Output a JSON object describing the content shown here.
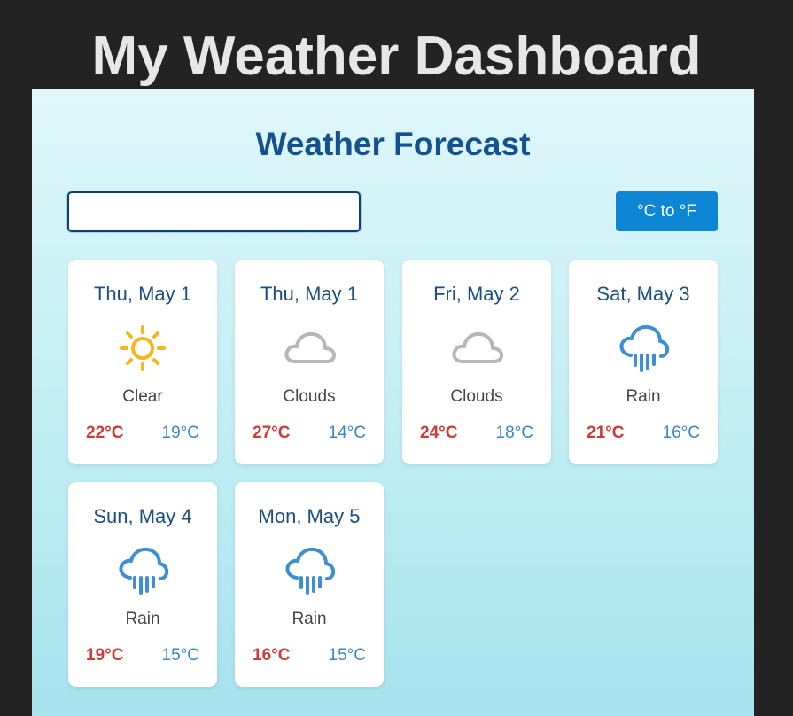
{
  "page": {
    "heading": "My Weather Dashboard"
  },
  "panel": {
    "title": "Weather Forecast",
    "search": {
      "value": "",
      "placeholder": ""
    },
    "unit_toggle_label": "°C to °F"
  },
  "forecast": [
    {
      "date": "Thu, May 1",
      "icon": "sun-icon",
      "condition": "Clear",
      "high": "22°C",
      "low": "19°C"
    },
    {
      "date": "Thu, May 1",
      "icon": "cloud-icon",
      "condition": "Clouds",
      "high": "27°C",
      "low": "14°C"
    },
    {
      "date": "Fri, May 2",
      "icon": "cloud-icon",
      "condition": "Clouds",
      "high": "24°C",
      "low": "18°C"
    },
    {
      "date": "Sat, May 3",
      "icon": "rain-icon",
      "condition": "Rain",
      "high": "21°C",
      "low": "16°C"
    },
    {
      "date": "Sun, May 4",
      "icon": "rain-icon",
      "condition": "Rain",
      "high": "19°C",
      "low": "15°C"
    },
    {
      "date": "Mon, May 5",
      "icon": "rain-icon",
      "condition": "Rain",
      "high": "16°C",
      "low": "15°C"
    }
  ],
  "colors": {
    "background": "#232323",
    "heading": "#e7e7e7",
    "title": "#13528e",
    "button": "#0d86d6",
    "high_temp": "#cf3a37",
    "low_temp": "#3a86c3",
    "sun": "#f3b81e",
    "cloud": "#b7b7b7",
    "rain": "#3d8fd2"
  }
}
